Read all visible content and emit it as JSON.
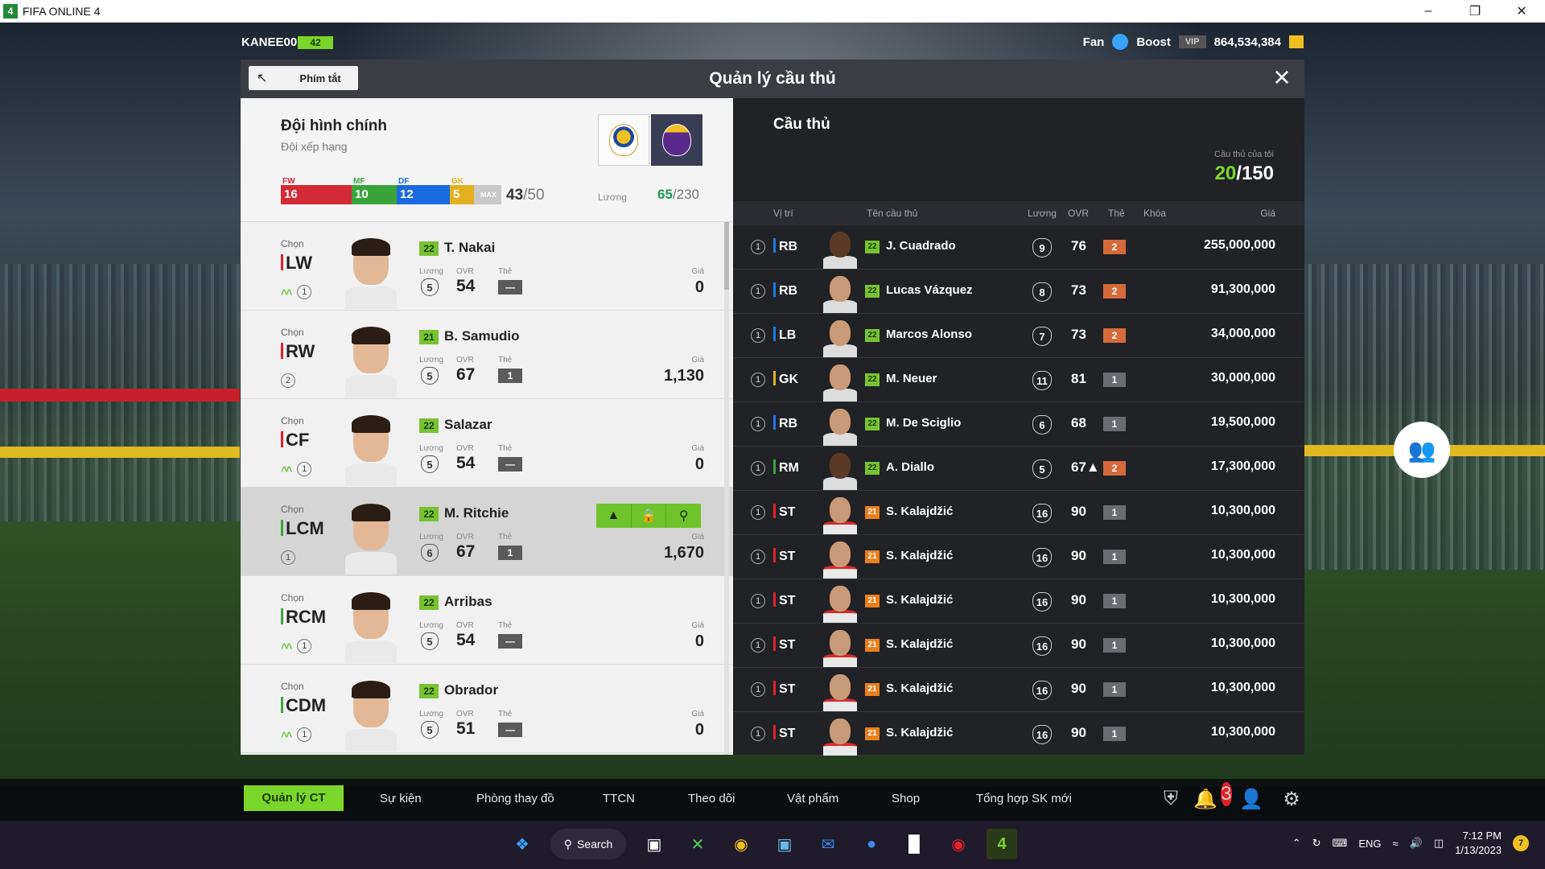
{
  "window": {
    "title": "FIFA ONLINE 4",
    "logo": "4"
  },
  "user": {
    "name": "KANEE007",
    "level": "42",
    "fan_label": "Fan",
    "boost_label": "Boost",
    "vip_label": "VIP",
    "coins": "864,534,384"
  },
  "modal": {
    "title": "Quản lý cầu thủ",
    "shortcut_label": "Phím tắt"
  },
  "lineup": {
    "title": "Đội hình chính",
    "subtitle": "Đội xếp hạng",
    "positions": [
      {
        "tag": "FW",
        "count": "16",
        "color": "#d42a35"
      },
      {
        "tag": "MF",
        "count": "10",
        "color": "#3aa43a"
      },
      {
        "tag": "DF",
        "count": "12",
        "color": "#1a6ae0"
      },
      {
        "tag": "GK",
        "count": "5",
        "color": "#e3b020"
      }
    ],
    "max_tag": "MAX",
    "count_current": "43",
    "count_max": "/50",
    "salary_label": "Lương",
    "salary_current": "65",
    "salary_max": "/230",
    "labels": {
      "choose": "Chọn",
      "salary": "Lương",
      "ovr": "OVR",
      "card": "Thẻ",
      "price": "Giá"
    }
  },
  "lineup_players": [
    {
      "pos": "LW",
      "season": "22",
      "name": "T. Nakai",
      "salary": "5",
      "ovr": "54",
      "card": "—",
      "price": "0",
      "rank": "1"
    },
    {
      "pos": "RW",
      "season": "21",
      "name": "B. Samudio",
      "salary": "5",
      "ovr": "67",
      "card": "1",
      "price": "1,130",
      "rank": "2"
    },
    {
      "pos": "CF",
      "season": "22",
      "name": "Salazar",
      "salary": "5",
      "ovr": "54",
      "card": "—",
      "price": "0",
      "rank": "1"
    },
    {
      "pos": "LCM",
      "season": "22",
      "name": "M. Ritchie",
      "salary": "6",
      "ovr": "67",
      "card": "1",
      "price": "1,670",
      "rank": "1"
    },
    {
      "pos": "RCM",
      "season": "22",
      "name": "Arribas",
      "salary": "5",
      "ovr": "54",
      "card": "—",
      "price": "0",
      "rank": "1"
    },
    {
      "pos": "CDM",
      "season": "22",
      "name": "Obrador",
      "salary": "5",
      "ovr": "51",
      "card": "—",
      "price": "0",
      "rank": "1"
    }
  ],
  "players_panel": {
    "title": "Cầu thủ",
    "my_players_label": "Cầu thủ của tôi",
    "my_players_current": "20",
    "my_players_max": "/150",
    "columns": {
      "pos": "Vị trí",
      "name": "Tên cầu thủ",
      "salary": "Lương",
      "ovr": "OVR",
      "card": "Thẻ",
      "lock": "Khóa",
      "price": "Giá"
    }
  },
  "players": [
    {
      "rank": "1",
      "pos": "RB",
      "season": "22",
      "name": "J. Cuadrado",
      "salary": "9",
      "ovr": "76",
      "card": "2",
      "price": "255,000,000"
    },
    {
      "rank": "1",
      "pos": "RB",
      "season": "22",
      "name": "Lucas Vázquez",
      "salary": "8",
      "ovr": "73",
      "card": "2",
      "price": "91,300,000"
    },
    {
      "rank": "1",
      "pos": "LB",
      "season": "22",
      "name": "Marcos Alonso",
      "salary": "7",
      "ovr": "73",
      "card": "2",
      "price": "34,000,000"
    },
    {
      "rank": "1",
      "pos": "GK",
      "season": "22",
      "name": "M. Neuer",
      "salary": "11",
      "ovr": "81",
      "card": "1",
      "price": "30,000,000"
    },
    {
      "rank": "1",
      "pos": "RB",
      "season": "22",
      "name": "M. De Sciglio",
      "salary": "6",
      "ovr": "68",
      "card": "1",
      "price": "19,500,000"
    },
    {
      "rank": "1",
      "pos": "RM",
      "season": "22",
      "name": "A. Diallo",
      "salary": "5",
      "ovr": "67▲",
      "card": "2",
      "price": "17,300,000"
    },
    {
      "rank": "1",
      "pos": "ST",
      "season": "21",
      "name": "S. Kalajdžić",
      "salary": "16",
      "ovr": "90",
      "card": "1",
      "price": "10,300,000"
    },
    {
      "rank": "1",
      "pos": "ST",
      "season": "21",
      "name": "S. Kalajdžić",
      "salary": "16",
      "ovr": "90",
      "card": "1",
      "price": "10,300,000"
    },
    {
      "rank": "1",
      "pos": "ST",
      "season": "21",
      "name": "S. Kalajdžić",
      "salary": "16",
      "ovr": "90",
      "card": "1",
      "price": "10,300,000"
    },
    {
      "rank": "1",
      "pos": "ST",
      "season": "21",
      "name": "S. Kalajdžić",
      "salary": "16",
      "ovr": "90",
      "card": "1",
      "price": "10,300,000"
    },
    {
      "rank": "1",
      "pos": "ST",
      "season": "21",
      "name": "S. Kalajdžić",
      "salary": "16",
      "ovr": "90",
      "card": "1",
      "price": "10,300,000"
    },
    {
      "rank": "1",
      "pos": "ST",
      "season": "21",
      "name": "S. Kalajdžić",
      "salary": "16",
      "ovr": "90",
      "card": "1",
      "price": "10,300,000"
    }
  ],
  "bottom_nav": {
    "items": [
      "Quản lý CT",
      "Sự kiện",
      "Phòng thay đồ",
      "TTCN",
      "Theo dõi",
      "Vật phẩm",
      "Shop",
      "Tổng hợp SK mới"
    ],
    "notification_count": "3"
  },
  "taskbar": {
    "search_label": "Search",
    "lang": "ENG",
    "time": "7:12 PM",
    "date": "1/13/2023",
    "badge": "7"
  }
}
